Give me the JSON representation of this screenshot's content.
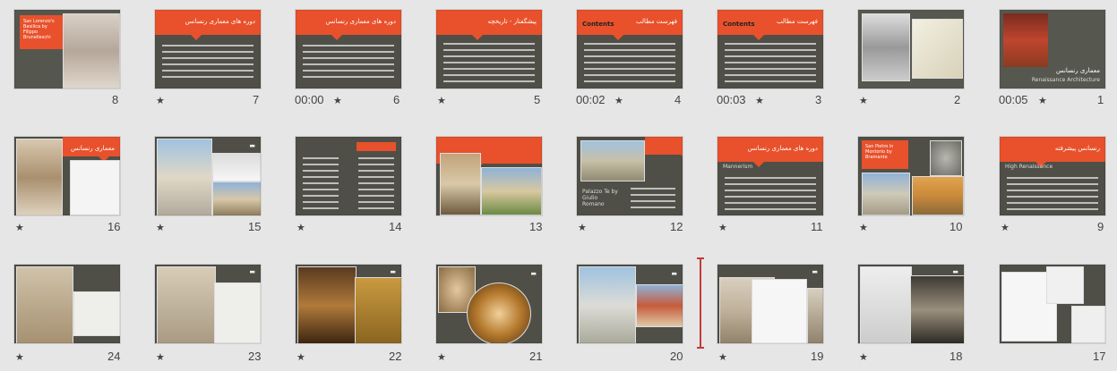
{
  "slides": [
    {
      "num": "1",
      "timing": "00:05",
      "starred": true,
      "title_rtl": "معماری رنسانس",
      "title_en": "Renaissance Architecture"
    },
    {
      "num": "2",
      "timing": "",
      "starred": true
    },
    {
      "num": "3",
      "timing": "00:03",
      "starred": true,
      "label_en": "Contents",
      "title_rtl": "فهرست مطالب"
    },
    {
      "num": "4",
      "timing": "00:02",
      "starred": true,
      "label_en": "Contents",
      "title_rtl": "فهرست مطالب"
    },
    {
      "num": "5",
      "timing": "",
      "starred": true,
      "title_rtl": "پیشگفتار - تاریخچه"
    },
    {
      "num": "6",
      "timing": "00:00",
      "starred": true,
      "title_rtl": "دوره های معماری رنسانس"
    },
    {
      "num": "7",
      "timing": "",
      "starred": true,
      "title_rtl": "دوره های معماری رنسانس"
    },
    {
      "num": "8",
      "timing": "",
      "starred": false,
      "title_en": "San Lorenzo's Basilica by Filippo Brunelleschi"
    },
    {
      "num": "9",
      "timing": "",
      "starred": true,
      "title_rtl": "رنسانس پیشرفته",
      "label_en": "High Renaissance"
    },
    {
      "num": "10",
      "timing": "",
      "starred": true,
      "title_en": "San Pietro in Montorio by Bramante"
    },
    {
      "num": "11",
      "timing": "",
      "starred": true,
      "title_rtl": "دوره های معماری رنسانس",
      "label_en": "Mannerism"
    },
    {
      "num": "12",
      "timing": "",
      "starred": true,
      "title_en": "Palazzo Te by Giulio Romano"
    },
    {
      "num": "13",
      "timing": "",
      "starred": false
    },
    {
      "num": "14",
      "timing": "",
      "starred": true
    },
    {
      "num": "15",
      "timing": "",
      "starred": true
    },
    {
      "num": "16",
      "timing": "",
      "starred": true,
      "title_rtl": "معماری رنسانس"
    },
    {
      "num": "17",
      "timing": "",
      "starred": false
    },
    {
      "num": "18",
      "timing": "",
      "starred": true
    },
    {
      "num": "19",
      "timing": "",
      "starred": true
    },
    {
      "num": "20",
      "timing": "",
      "starred": false
    },
    {
      "num": "21",
      "timing": "",
      "starred": true
    },
    {
      "num": "22",
      "timing": "",
      "starred": true
    },
    {
      "num": "23",
      "timing": "",
      "starred": true
    },
    {
      "num": "24",
      "timing": "",
      "starred": true
    }
  ],
  "ui": {
    "star_glyph": "★"
  }
}
